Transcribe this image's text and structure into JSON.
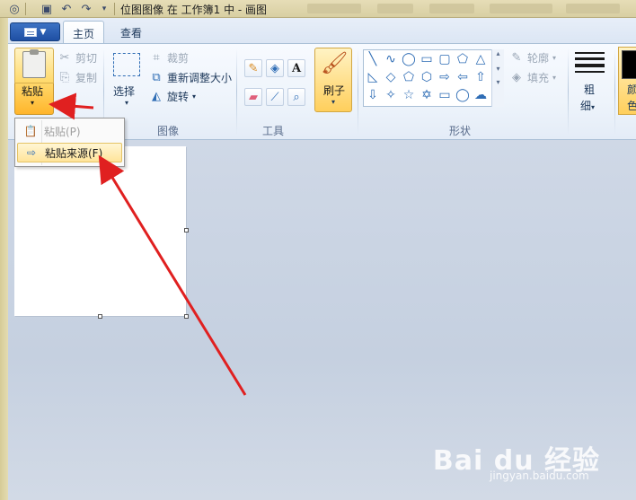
{
  "title_bar": {
    "text": "位图图像 在 工作簿1 中 - 画图"
  },
  "tabs": [
    {
      "label": "主页",
      "active": true
    },
    {
      "label": "查看",
      "active": false
    }
  ],
  "clipboard_group": {
    "paste_label": "粘贴",
    "cut_label": "剪切",
    "copy_label": "复制"
  },
  "image_group": {
    "select_label": "选择",
    "crop_label": "裁剪",
    "resize_label": "重新调整大小",
    "rotate_label": "旋转",
    "group_label": "图像"
  },
  "tools_group": {
    "group_label": "工具",
    "brush_label": "刷子"
  },
  "shapes_group": {
    "outline_label": "轮廓",
    "fill_label": "填充",
    "group_label": "形状",
    "shapes": [
      "line",
      "curve",
      "oval",
      "rectangle",
      "rounded-rectangle",
      "polygon",
      "triangle",
      "right-triangle",
      "diamond",
      "pentagon",
      "hexagon",
      "right-arrow",
      "left-arrow",
      "up-arrow",
      "down-arrow",
      "four-point-star",
      "five-point-star",
      "six-point-star",
      "rounded-callout",
      "oval-callout",
      "cloud-callout"
    ]
  },
  "size_group": {
    "label_line1": "粗",
    "label_line2": "细"
  },
  "color_group": {
    "label_line1": "颜",
    "label_line2": "色"
  },
  "paste_menu": {
    "paste_item": "粘贴(P)",
    "paste_from_item": "粘贴来源(F)"
  },
  "watermark": {
    "brand": "Bai du 经验",
    "url": "jingyan.baidu.com"
  },
  "colors": {
    "accent_red": "#e02020",
    "ribbon_highlight": "#ffd96a"
  }
}
